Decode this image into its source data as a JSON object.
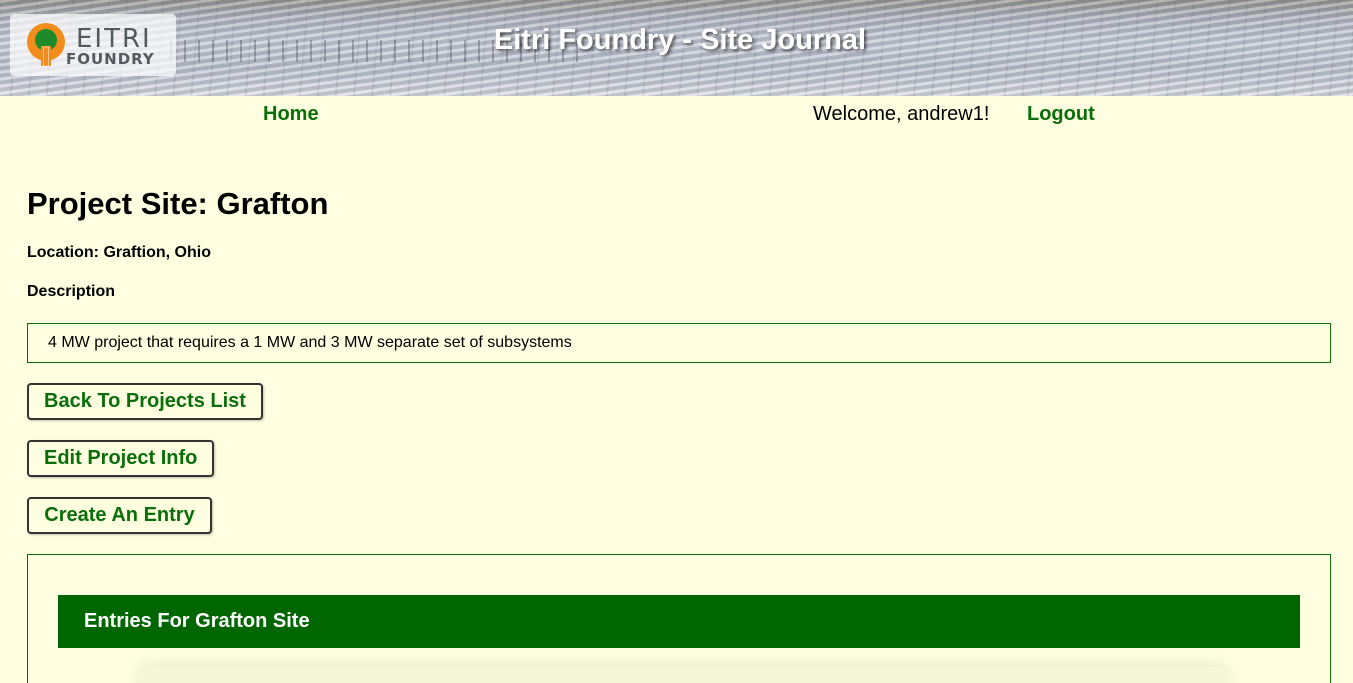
{
  "header": {
    "logo_text_line1": "EITRI",
    "logo_text_line2": "FOUNDRY",
    "title": "Eitri Foundry - Site Journal"
  },
  "nav": {
    "home": "Home",
    "welcome": "Welcome, andrew1!",
    "logout": "Logout"
  },
  "project": {
    "title": "Project Site: Grafton",
    "location": "Location: Graftion, Ohio",
    "description_label": "Description",
    "description": "4 MW project that requires a 1 MW and 3 MW separate set of subsystems"
  },
  "buttons": {
    "back": "Back To Projects List",
    "edit": "Edit Project Info",
    "create": "Create An Entry"
  },
  "entries": {
    "header": "Entries For Grafton Site"
  },
  "colors": {
    "accent_green": "#0a6e0a",
    "header_green": "#006600",
    "page_bg": "#fefee0",
    "logo_orange": "#f28c1c"
  }
}
